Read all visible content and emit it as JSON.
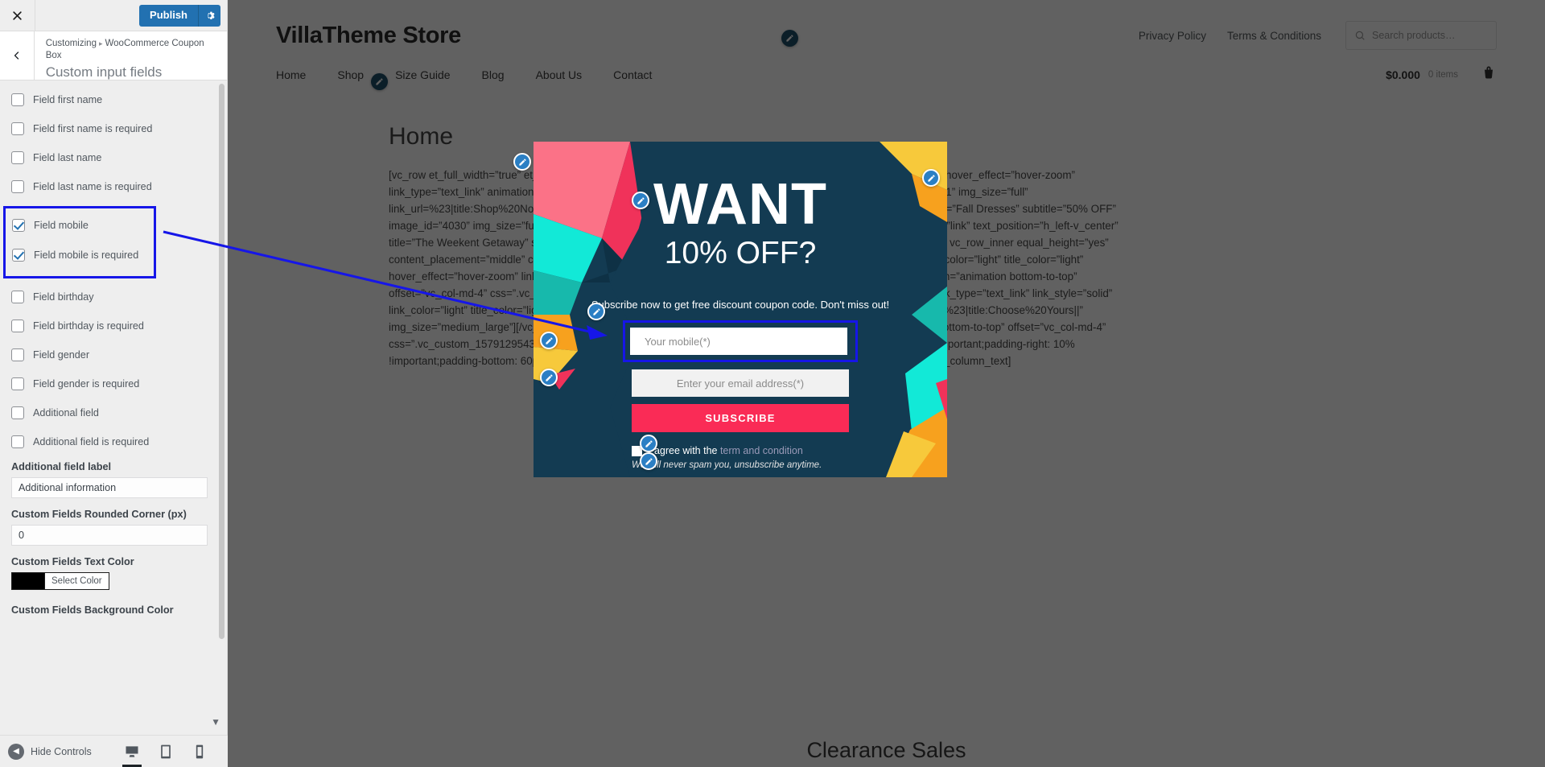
{
  "customizer": {
    "close_icon": "close-icon",
    "publish_label": "Publish",
    "gear_icon": "gear-icon",
    "back_icon": "chevron-left-icon",
    "breadcrumb_root": "Customizing",
    "breadcrumb_sep": "▸",
    "breadcrumb_section": "WooCommerce Coupon Box",
    "panel_title": "Custom input fields",
    "checkboxes": [
      {
        "label": "Field first name",
        "checked": false,
        "highlighted": false
      },
      {
        "label": "Field first name is required",
        "checked": false,
        "highlighted": false
      },
      {
        "label": "Field last name",
        "checked": false,
        "highlighted": false
      },
      {
        "label": "Field last name is required",
        "checked": false,
        "highlighted": false
      },
      {
        "label": "Field mobile",
        "checked": true,
        "highlighted": true
      },
      {
        "label": "Field mobile is required",
        "checked": true,
        "highlighted": true
      },
      {
        "label": "Field birthday",
        "checked": false,
        "highlighted": false
      },
      {
        "label": "Field birthday is required",
        "checked": false,
        "highlighted": false
      },
      {
        "label": "Field gender",
        "checked": false,
        "highlighted": false
      },
      {
        "label": "Field gender is required",
        "checked": false,
        "highlighted": false
      },
      {
        "label": "Additional field",
        "checked": false,
        "highlighted": false
      },
      {
        "label": "Additional field is required",
        "checked": false,
        "highlighted": false
      }
    ],
    "additional_field_label_title": "Additional field label",
    "additional_field_label_value": "Additional information",
    "rounded_corner_title": "Custom Fields Rounded Corner (px)",
    "rounded_corner_value": "0",
    "text_color_title": "Custom Fields Text Color",
    "text_color_button": "Select Color",
    "text_color_value": "#000000",
    "background_color_title": "Custom Fields Background Color",
    "caret_icon": "chevron-down-icon",
    "footer": {
      "hide_controls_label": "Hide Controls",
      "hide_controls_icon": "collapse-arrow-icon",
      "devices": [
        {
          "name": "desktop",
          "icon": "desktop-icon",
          "active": true
        },
        {
          "name": "tablet",
          "icon": "tablet-icon",
          "active": false
        },
        {
          "name": "mobile",
          "icon": "mobile-icon",
          "active": false
        }
      ]
    }
  },
  "site": {
    "brand": "VillaTheme Store",
    "top_links": [
      "Privacy Policy",
      "Terms & Conditions"
    ],
    "search_placeholder": "Search products…",
    "search_icon": "search-icon",
    "nav": [
      "Home",
      "Shop",
      "Size Guide",
      "Blog",
      "About Us",
      "Contact"
    ],
    "cart_price": "$0.000",
    "cart_items": "0 items",
    "cart_icon": "basket-icon",
    "page_title": "Home",
    "shortcode": "[vc_row et_full_width=”true” et_banner_slider arrows=”1” pagination=”1\" infinite=”1\" animation_class=”” height=”100” hover_effect=”hover-zoom” link_type=”text_link” animation=”et-fadeInUp” text_position=”h_right-v_center” title=”Women Dresses” image_id=”4031” img_size=”full” link_url=%23|title:Shop%20Now|| title_type=”h2” link_style=”link” title_size=”xxlarge” subtitle_type=”p”][et_banner title=”Fall Dresses” subtitle=”50% OFF” image_id=”4030” img_size=”full” animation=”et-fadeInUp” hover_effect=”hover-zoom” link_type=”text_link” link_style=”link” text_position=”h_left-v_center” title=”The Weekent Getaway” subtitle=”All Styles”][/et_banner_slider][/vc_column_inner][/vc_column][/vc_row][vc_row vc_row_inner equal_height=”yes” content_placement=”middle” css=”.vc_custom_1579111806249{margin-top: 15px !important;}” link_style=”solid” link_color=”light” title_color=”light” hover_effect=”hover-zoom” link_type=”text_link” link=”url:%23|title:Buy%20Now|” img_size=”medium_large” animation=”animation bottom-to-top” offset=”vc_col-md-4” css=”.vc_custom_1579111815438{margin-top: 15px !important;}” hover_effect=”hover-zoom” link_type=”text_link” link_style=”solid” link_color=”light” title_color=”light” text_alignment=”align_center” image_id=”3813” title=”Choose your price” link=”url:%23|title:Choose%20Yours||” img_size=”medium_large”][/vc_column_inner][vc_column_inner et_column=”et-light-column” animation=”animation bottom-to-top” offset=”vc_col-md-4” css=”.vc_custom_1579129543433{margin-top: 15px !important;margin-bottom: 15px !important;padding-top: 60px !important;padding-right: 10% !important;padding-bottom: 60px !important;padding-left: 10% !important;background-color: #c7ab62 !important;}”][vc_column_text]",
    "clearance_title": "Clearance Sales"
  },
  "popup": {
    "close_icon": "close-icon",
    "headline": "WANT",
    "subheadline": "10% OFF?",
    "description": "Subscribe now to get free discount coupon code. Don't miss out!",
    "mobile_placeholder": "Your mobile(*)",
    "email_placeholder": "Enter your email address(*)",
    "subscribe_label": "SUBSCRIBE",
    "agree_text": "I agree with the",
    "agree_link": "term and condition",
    "spam_text": "We will never spam you, unsubscribe anytime.",
    "accent_color": "#fa2b56",
    "bg_color": "#133b52"
  },
  "annotation": {
    "highlight_color": "#1616e8",
    "arrow_icon": "arrow-pointer"
  }
}
